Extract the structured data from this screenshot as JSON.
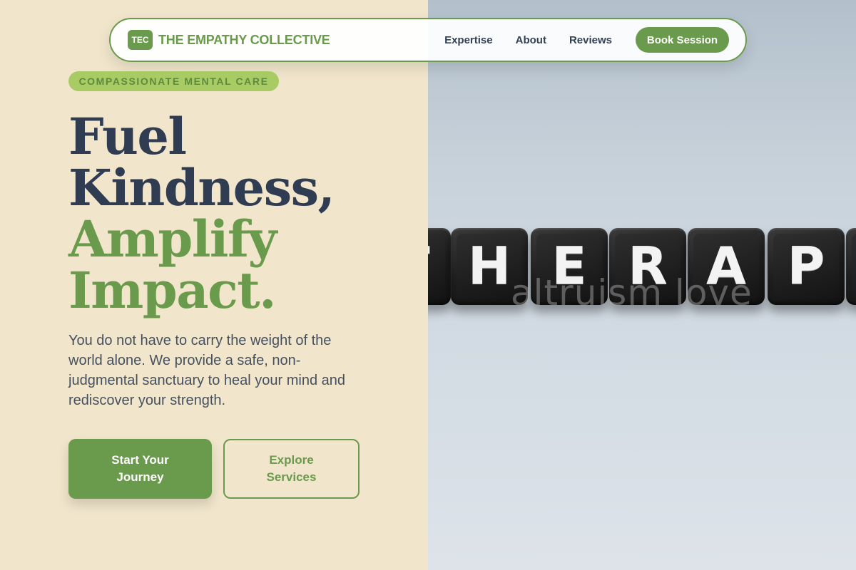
{
  "brand": {
    "logo_badge": "TEC",
    "name": "THE EMPATHY COLLECTIVE",
    "color": "#6a9a4b"
  },
  "nav": {
    "links": [
      "Expertise",
      "About",
      "Reviews"
    ],
    "cta": "Book Session"
  },
  "hero": {
    "tagline": "COMPASSIONATE MENTAL CARE",
    "headline_line1": "Fuel",
    "headline_line2": "Kindness,",
    "headline_line3": "Amplify",
    "headline_line4": "Impact.",
    "description": "You do not have to carry the weight of the world alone. We provide a safe, non-judgmental sanctuary to heal your mind and rediscover your strength.",
    "primary_button": "Start Your Journey",
    "secondary_button": "Explore Services"
  },
  "image": {
    "tile_letters": [
      "T",
      "H",
      "E",
      "R",
      "A",
      "P"
    ],
    "watermark": "altruism love"
  },
  "colors": {
    "background_left": "#f1e6cc",
    "headline_dark": "#2f3c52",
    "accent_green": "#6a9a4b",
    "tagline_bg": "#a9cb64"
  }
}
